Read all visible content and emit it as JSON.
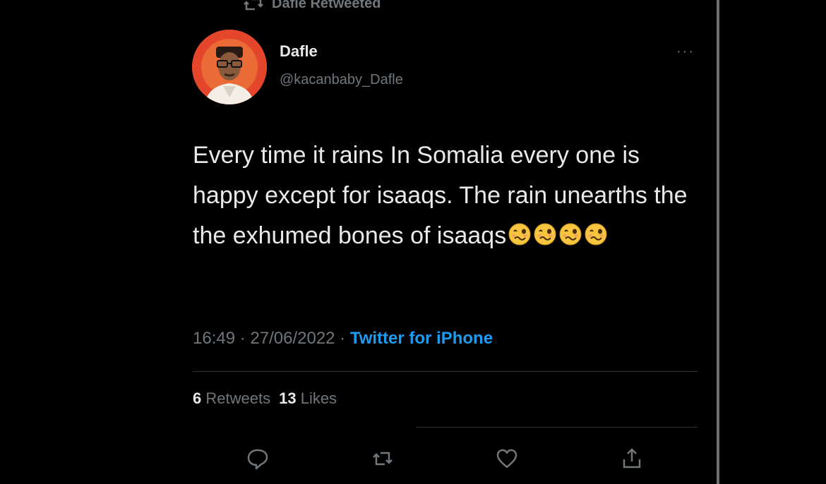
{
  "retweet_banner": {
    "text": "Dafle Retweeted",
    "icon": "retweet-icon"
  },
  "author": {
    "display_name": "Dafle",
    "handle": "@kacanbaby_Dafle",
    "avatar": "avatar"
  },
  "more_menu": {
    "icon": "more-icon",
    "label": "···"
  },
  "tweet": {
    "text": "Every time it rains In Somalia every one is happy except for isaaqs. The rain unearths the the exhumed bones of isaaqs",
    "emojis": [
      "woozy-face-icon",
      "woozy-face-icon",
      "woozy-face-icon",
      "woozy-face-icon"
    ]
  },
  "meta": {
    "time": "16:49",
    "separator": " · ",
    "date": "27/06/2022",
    "source": "Twitter for iPhone"
  },
  "stats": {
    "retweets_count": "6",
    "retweets_label": "Retweets",
    "likes_count": "13",
    "likes_label": "Likes"
  },
  "actions": [
    {
      "name": "reply",
      "icon": "reply-icon"
    },
    {
      "name": "retweet",
      "icon": "retweet-icon"
    },
    {
      "name": "like",
      "icon": "heart-icon"
    },
    {
      "name": "share",
      "icon": "share-icon"
    }
  ],
  "colors": {
    "background": "#000000",
    "text": "#e7e9ea",
    "muted": "#71767b",
    "accent": "#1d9bf0",
    "divider": "#2f3336"
  }
}
